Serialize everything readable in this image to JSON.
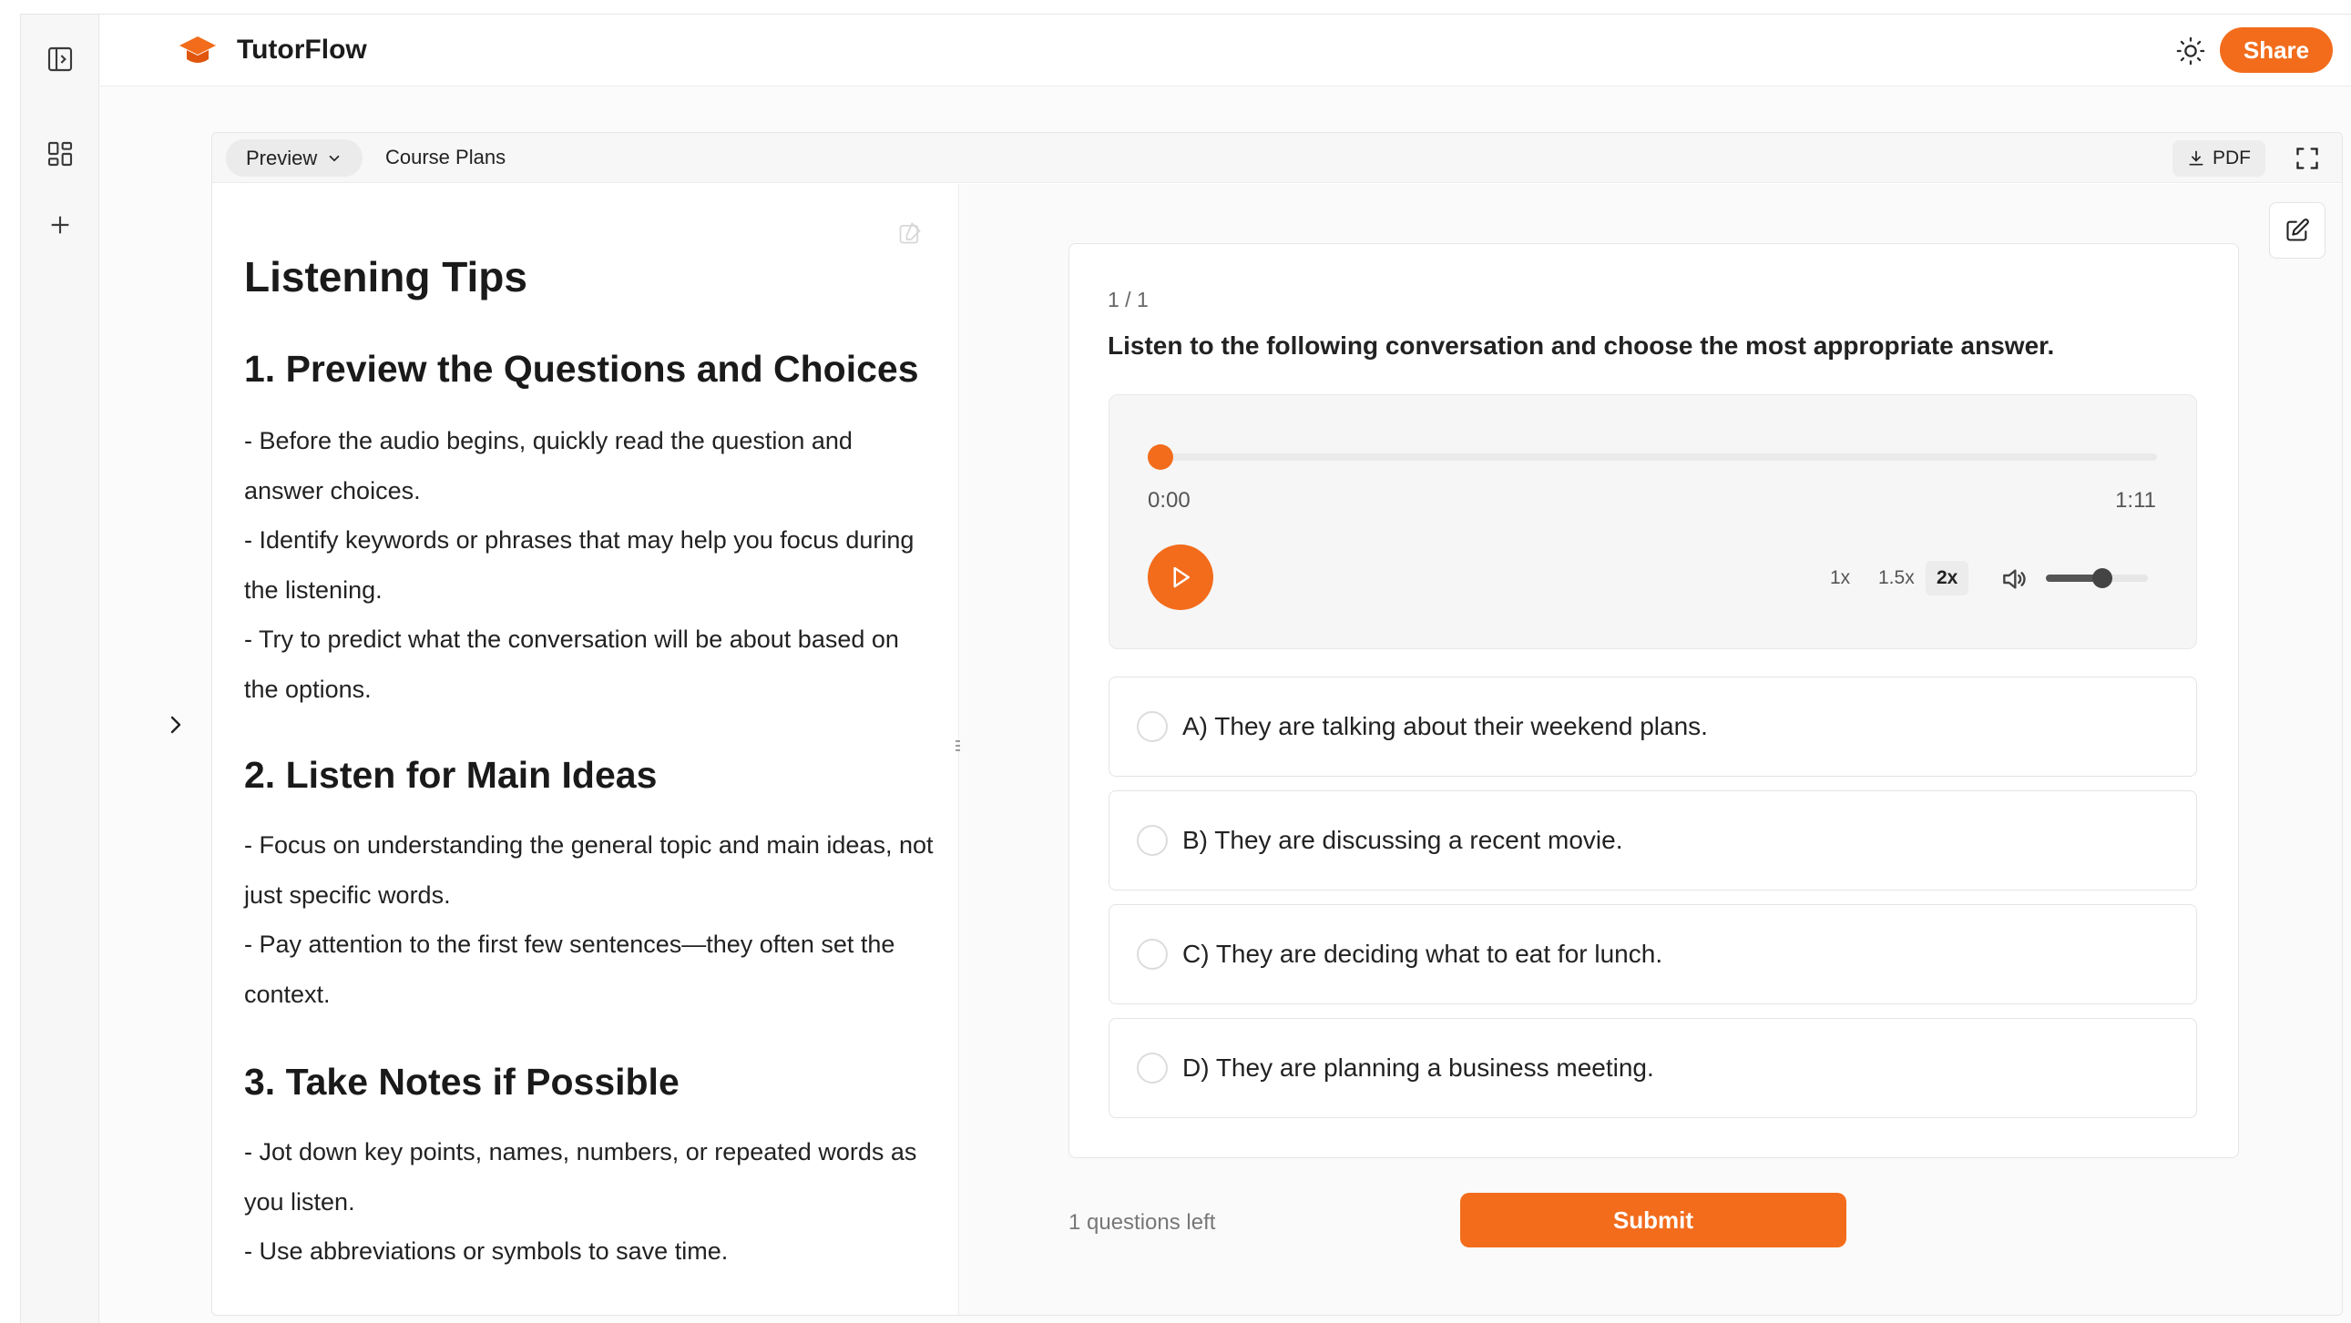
{
  "app": {
    "title": "TutorFlow",
    "share_label": "Share"
  },
  "tabs": {
    "preview_label": "Preview",
    "course_plans_label": "Course Plans",
    "pdf_label": "PDF"
  },
  "doc": {
    "title": "Listening Tips",
    "sections": [
      {
        "heading": "1. Preview the Questions and Choices",
        "bullets": [
          "- Before the audio begins, quickly read the question and answer choices.",
          "- Identify keywords or phrases that may help you focus during the listening.",
          "- Try to predict what the conversation will be about based on the options."
        ]
      },
      {
        "heading": "2. Listen for Main Ideas",
        "bullets": [
          "- Focus on understanding the general topic and main ideas, not just specific words.",
          "- Pay attention to the first few sentences—they often set the context."
        ]
      },
      {
        "heading": "3. Take Notes if Possible",
        "bullets": [
          "- Jot down key points, names, numbers, or repeated words as you listen.",
          "- Use abbreviations or symbols to save time."
        ]
      }
    ]
  },
  "quiz": {
    "counter": "1 / 1",
    "question": "Listen to the following conversation and choose the most appropriate answer.",
    "player": {
      "current_time": "0:00",
      "duration": "1:11",
      "progress": 0.0,
      "speeds": [
        "1x",
        "1.5x",
        "2x"
      ],
      "active_speed": "2x",
      "volume": 0.55
    },
    "options": [
      "A) They are talking about their weekend plans.",
      "B) They are discussing a recent movie.",
      "C) They are deciding what to eat for lunch.",
      "D) They are planning a business meeting."
    ],
    "questions_left": "1 questions left",
    "submit_label": "Submit"
  },
  "colors": {
    "accent": "#f26c1c"
  },
  "icons": {
    "rail": [
      "sidebar-toggle-icon",
      "dashboard-grid-icon",
      "plus-icon"
    ],
    "header": [
      "sun-icon"
    ],
    "toolbar": [
      "download-icon",
      "fullscreen-icon",
      "edit-icon"
    ],
    "player": [
      "play-icon",
      "volume-icon"
    ]
  }
}
